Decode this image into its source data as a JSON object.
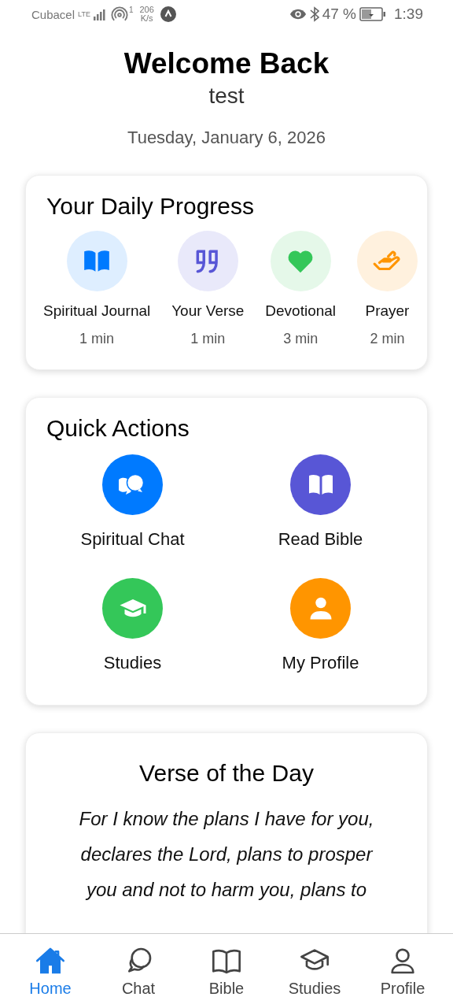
{
  "status_bar": {
    "carrier": "Cubacel",
    "network": "LTE",
    "hotspot_count": "1",
    "speed_value": "206",
    "speed_unit": "K/s",
    "battery": "47 %",
    "time": "1:39"
  },
  "header": {
    "title": "Welcome Back",
    "username": "test",
    "date": "Tuesday, January 6, 2026"
  },
  "daily_progress": {
    "title": "Your Daily Progress",
    "items": [
      {
        "label": "Spiritual Journal",
        "duration": "1 min",
        "color": "#007aff"
      },
      {
        "label": "Your Verse",
        "duration": "1 min",
        "color": "#5856d6"
      },
      {
        "label": "Devotional",
        "duration": "3 min",
        "color": "#34c759"
      },
      {
        "label": "Prayer",
        "duration": "2 min",
        "color": "#ff9500"
      }
    ]
  },
  "quick_actions": {
    "title": "Quick Actions",
    "items": [
      {
        "label": "Spiritual Chat",
        "color": "#007aff"
      },
      {
        "label": "Read Bible",
        "color": "#5856d6"
      },
      {
        "label": "Studies",
        "color": "#34c759"
      },
      {
        "label": "My Profile",
        "color": "#ff9500"
      }
    ]
  },
  "verse_of_the_day": {
    "title": "Verse of the Day",
    "text": "For I know the plans I have for you, declares the Lord, plans to prosper you and not to harm you, plans to"
  },
  "bottom_nav": [
    {
      "label": "Home",
      "selected": true
    },
    {
      "label": "Chat",
      "selected": false
    },
    {
      "label": "Bible",
      "selected": false
    },
    {
      "label": "Studies",
      "selected": false
    },
    {
      "label": "Profile",
      "selected": false
    }
  ]
}
